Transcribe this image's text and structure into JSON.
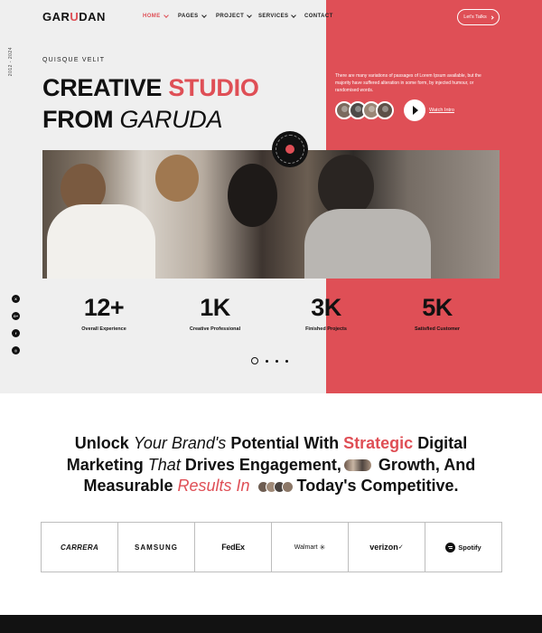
{
  "brand": {
    "logo_pre": "GAR",
    "logo_accent": "U",
    "logo_post": "DAN"
  },
  "nav": {
    "items": [
      {
        "label": "HOME"
      },
      {
        "label": "PAGES"
      },
      {
        "label": "PROJECT"
      },
      {
        "label": "SERVICES"
      },
      {
        "label": "CONTACT"
      }
    ],
    "cta_label": "Let's Talks"
  },
  "hero": {
    "year": "2012 - 2024",
    "kicker": "QUISQUE VELIT",
    "title_line1_a": "CREATIVE ",
    "title_line1_b": "STUDIO",
    "title_line2_a": "FROM ",
    "title_line2_b": "GARUDA",
    "description": "There are many variations of passages of Lorem Ipsum available, but the majority have suffered alteration in some form, by injected humour, or randomised words.",
    "watch_label": "Watch Intro",
    "badge_icon": "circular-text-badge"
  },
  "stats": [
    {
      "value": "12+",
      "label": "Overall Experience"
    },
    {
      "value": "1K",
      "label": "Creative Professional"
    },
    {
      "value": "3K",
      "label": "Finished Projects"
    },
    {
      "value": "5K",
      "label": "Satisfied Customer"
    }
  ],
  "social": [
    {
      "icon": "x-icon",
      "glyph": "X"
    },
    {
      "icon": "google-icon",
      "glyph": "G+"
    },
    {
      "icon": "facebook-icon",
      "glyph": "f"
    },
    {
      "icon": "instagram-icon",
      "glyph": "◎"
    }
  ],
  "headline": {
    "w1": "Unlock ",
    "w2": "Your Brand's ",
    "w3": "Potential With ",
    "w4": "Strategic ",
    "w5": "Digital",
    "w6": "Marketing ",
    "w7": "That ",
    "w8": "Drives Engagement,",
    "w9": " Growth, And",
    "w10": "Measurable ",
    "w11": "Results In ",
    "w12": " Today's Competitive."
  },
  "brands": [
    "CARRERA",
    "SAMSUNG",
    "FedEx",
    "Walmart",
    "verizon",
    "Spotify"
  ],
  "colors": {
    "accent": "#df4f56",
    "dark": "#111111",
    "light": "#efefef"
  }
}
